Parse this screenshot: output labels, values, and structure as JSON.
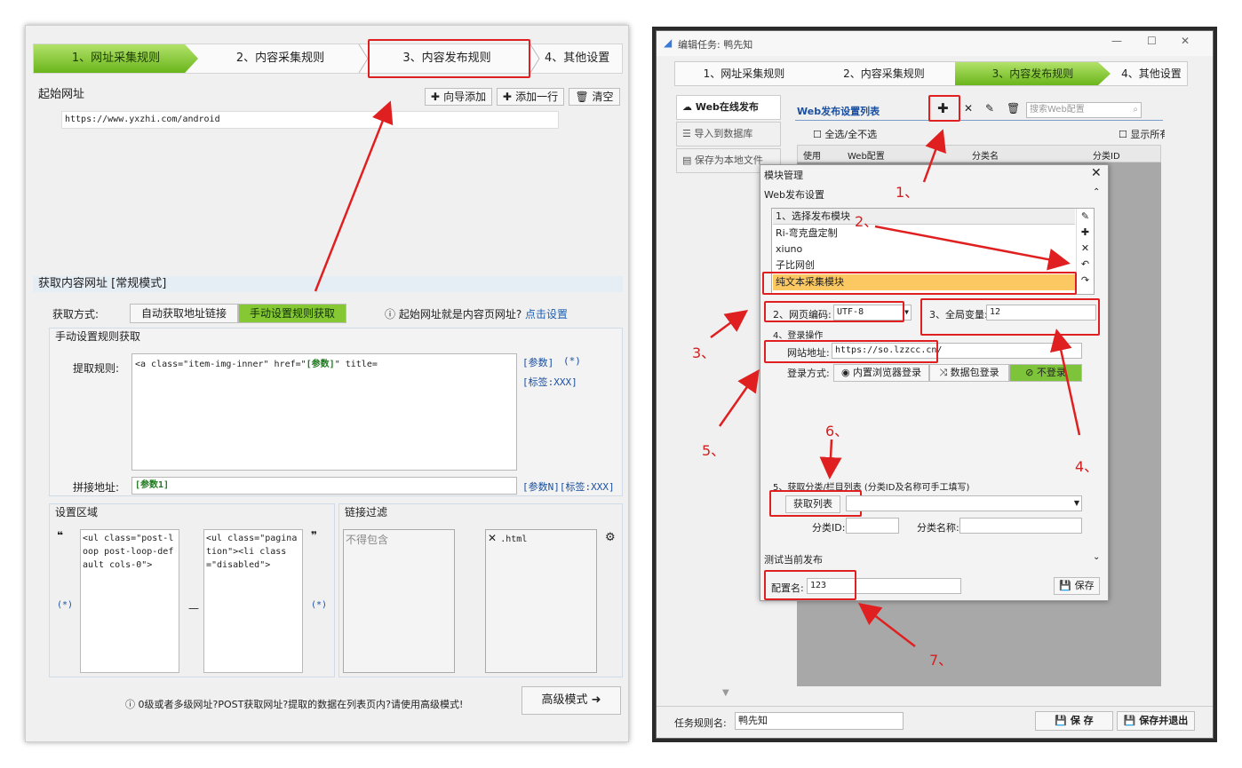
{
  "left": {
    "tabs": [
      "1、网址采集规则",
      "2、内容采集规则",
      "3、内容发布规则",
      "4、其他设置"
    ],
    "start_url_section": "起始网址",
    "wizard_add": "向导添加",
    "add_row": "添加一行",
    "clear": "清空",
    "start_url": "https://www.yxzhi.com/android",
    "fetch_section": "获取内容网址 [常规模式]",
    "fetch_method_label": "获取方式:",
    "auto_fetch": "自动获取地址链接",
    "manual_fetch": "手动设置规则获取",
    "hint_question": "起始网址就是内容页网址?",
    "hint_link": "点击设置",
    "manual_group": "手动设置规则获取",
    "extract_rule_label": "提取规则:",
    "extract_rule_pre": "<a class=\"item-img-inner\" href=\"",
    "extract_rule_param": "[参数]",
    "extract_rule_post": "\" title=",
    "param_tag": "[参数]",
    "wildcard_tag": "(*)",
    "label_tag": "[标签:XXX]",
    "join_label": "拼接地址:",
    "join_value": "[参数1]",
    "join_tags": "[参数N][标签:XXX]",
    "area_title": "设置区域",
    "area_left_code": "<ul class=\"post-loop post-loop-default cols-0\">",
    "area_right_code": "<ul class=\"pagination\"><li class=\"disabled\">",
    "area_wild_left": "(*)",
    "area_wild_right": "(*)",
    "quote_open": "❝",
    "quote_close": "❞",
    "dash": "—",
    "filter_title": "链接过滤",
    "exclude_placeholder": "不得包含",
    "include_item": ".html",
    "bottom_hint": "0级或者多级网址?POST获取网址?提取的数据在列表页内?请使用高级模式!",
    "advanced": "高级模式"
  },
  "right": {
    "window_title": "编辑任务: 鸭先知",
    "tabs": [
      "1、网址采集规则",
      "2、内容采集规则",
      "3、内容发布规则",
      "4、其他设置"
    ],
    "side_items": [
      "Web在线发布",
      "导入到数据库",
      "保存为本地文件"
    ],
    "publish_list_title": "Web发布设置列表",
    "search_placeholder": "搜索Web配置",
    "select_all": "全选/全不选",
    "show_all": "显示所有",
    "columns": [
      "使用",
      "Web配置",
      "分类名",
      "分类ID"
    ],
    "dialog": {
      "title": "模块管理",
      "section": "Web发布设置",
      "modules_header": "1、选择发布模块",
      "modules": [
        "Ri-弯克盘定制",
        "xiuno",
        "子比网创",
        "纯文本采集模块"
      ],
      "encoding_label": "2、网页编码:",
      "encoding_value": "UTF-8",
      "global_var_label": "3、全局变量:",
      "global_var_value": "12",
      "login_section": "4、登录操作",
      "site_label": "网站地址:",
      "site_value": "https://so.lzzcc.cn/",
      "login_method_label": "登录方式:",
      "login_builtin": "内置浏览器登录",
      "login_packet": "数据包登录",
      "login_none": "不登录",
      "category_section": "5、获取分类/栏目列表 (分类ID及名称可手工填写)",
      "get_list": "获取列表",
      "cat_id_label": "分类ID:",
      "cat_name_label": "分类名称:",
      "test_section": "测试当前发布",
      "config_label": "配置名:",
      "config_value": "123",
      "save": "保存"
    },
    "task_name_label": "任务规则名:",
    "task_name_value": "鸭先知",
    "save": "保 存",
    "save_exit": "保存并退出"
  },
  "annotations": [
    "1、",
    "2、",
    "3、",
    "4、",
    "5、",
    "6、",
    "7、"
  ]
}
